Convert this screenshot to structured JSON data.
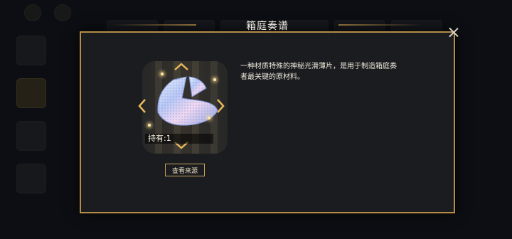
{
  "dialog": {
    "title": "箱庭奏谱"
  },
  "item": {
    "owned_label": "持有:1",
    "source_button": "查看来源",
    "description": "一种材质特殊的神秘光滑薄片，是用于制造箱庭奏者最关键的原材料。"
  },
  "colors": {
    "frame_gold": "#b58d47",
    "panel_bg": "#1c1d21",
    "text_light": "#ece7db"
  },
  "icons": {
    "close": "close-icon",
    "up": "chevron-up-icon",
    "down": "chevron-down-icon",
    "left": "chevron-left-icon",
    "right": "chevron-right-icon"
  }
}
